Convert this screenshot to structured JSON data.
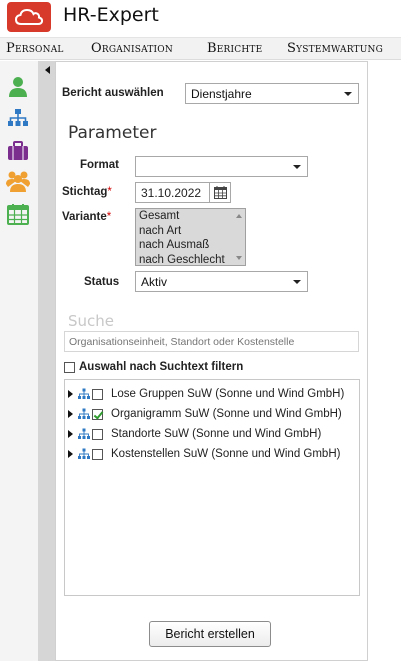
{
  "app": {
    "title": "HR-Expert"
  },
  "menu": [
    "Personal",
    "Organisation",
    "Berichte",
    "Systemwartung"
  ],
  "sidebar": {
    "icons": [
      "person-icon",
      "org-chart-icon",
      "briefcase-icon",
      "group-icon",
      "calendar-icon"
    ]
  },
  "report": {
    "select_label": "Bericht auswählen",
    "selected": "Dienstjahre"
  },
  "parameters": {
    "title": "Parameter",
    "format_label": "Format",
    "format_value": "",
    "stichtag_label": "Stichtag",
    "required_marker": "*",
    "stichtag_value": "31.10.2022",
    "variante_label": "Variante",
    "variante_options": [
      "Gesamt",
      "nach Art",
      "nach Ausmaß",
      "nach Geschlecht"
    ],
    "status_label": "Status",
    "status_value": "Aktiv"
  },
  "search": {
    "title": "Suche",
    "placeholder": "Organisationseinheit, Standort oder Kostenstelle",
    "filter_label": "Auswahl nach Suchtext filtern"
  },
  "tree": {
    "items": [
      {
        "label": "Lose Gruppen SuW (Sonne und Wind GmbH)",
        "checked": false
      },
      {
        "label": "Organigramm SuW (Sonne und Wind GmbH)",
        "checked": true
      },
      {
        "label": "Standorte SuW (Sonne und Wind GmbH)",
        "checked": false
      },
      {
        "label": "Kostenstellen SuW (Sonne und Wind GmbH)",
        "checked": false
      }
    ]
  },
  "actions": {
    "create_label": "Bericht erstellen"
  },
  "colors": {
    "brand": "#d7392b",
    "icon_green": "#4caf50",
    "icon_blue": "#2f78c4",
    "icon_purple": "#7b2e8e",
    "icon_orange": "#f0a030",
    "check_green": "#2e9b2e"
  }
}
